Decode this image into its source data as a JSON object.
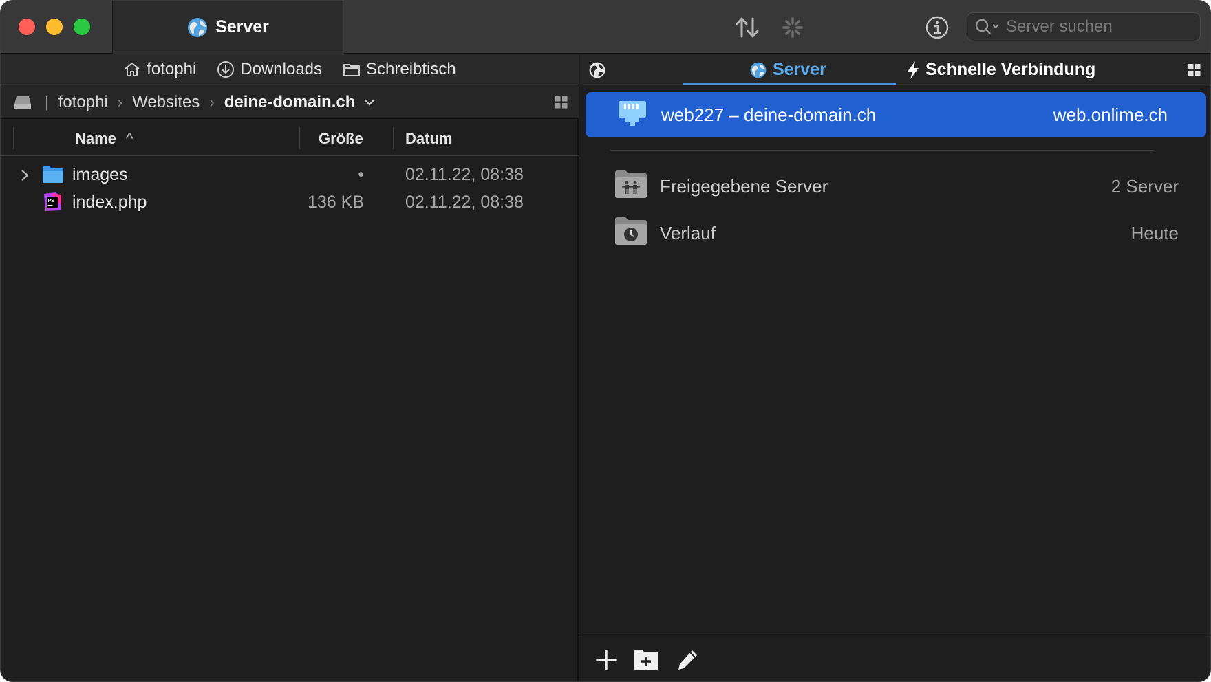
{
  "window": {
    "title": "Server",
    "search": {
      "placeholder": "Server suchen",
      "value": ""
    }
  },
  "toolbar": {
    "icons": [
      "transfer-arrows-icon",
      "activity-spinner-icon",
      "info-icon",
      "search-icon"
    ]
  },
  "favorites": [
    {
      "label": "fotophi",
      "icon": "home-icon"
    },
    {
      "label": "Downloads",
      "icon": "download-icon"
    },
    {
      "label": "Schreibtisch",
      "icon": "folder-icon"
    }
  ],
  "path": {
    "segments": [
      "fotophi",
      "Websites"
    ],
    "current": "deine-domain.ch"
  },
  "columns": {
    "name": "Name",
    "size": "Größe",
    "date": "Datum"
  },
  "files": [
    {
      "name": "images",
      "size": "•",
      "date": "02.11.22, 08:38",
      "kind": "folder"
    },
    {
      "name": "index.php",
      "size": "136 KB",
      "date": "02.11.22, 08:38",
      "kind": "phpstorm-file"
    }
  ],
  "tabs": {
    "server": "Server",
    "quick_connect": "Schnelle Verbindung"
  },
  "servers": {
    "selected": {
      "label": "web227 – deine-domain.ch",
      "host": "web.onlime.ch"
    },
    "groups": [
      {
        "label": "Freigegebene Server",
        "count": "2 Server",
        "icon": "shared-folder-icon"
      },
      {
        "label": "Verlauf",
        "count": "Heute",
        "icon": "history-folder-icon"
      }
    ]
  },
  "colors": {
    "accent": "#5aa9ea",
    "selection": "#2060d0",
    "background": "#1e1e1e"
  }
}
